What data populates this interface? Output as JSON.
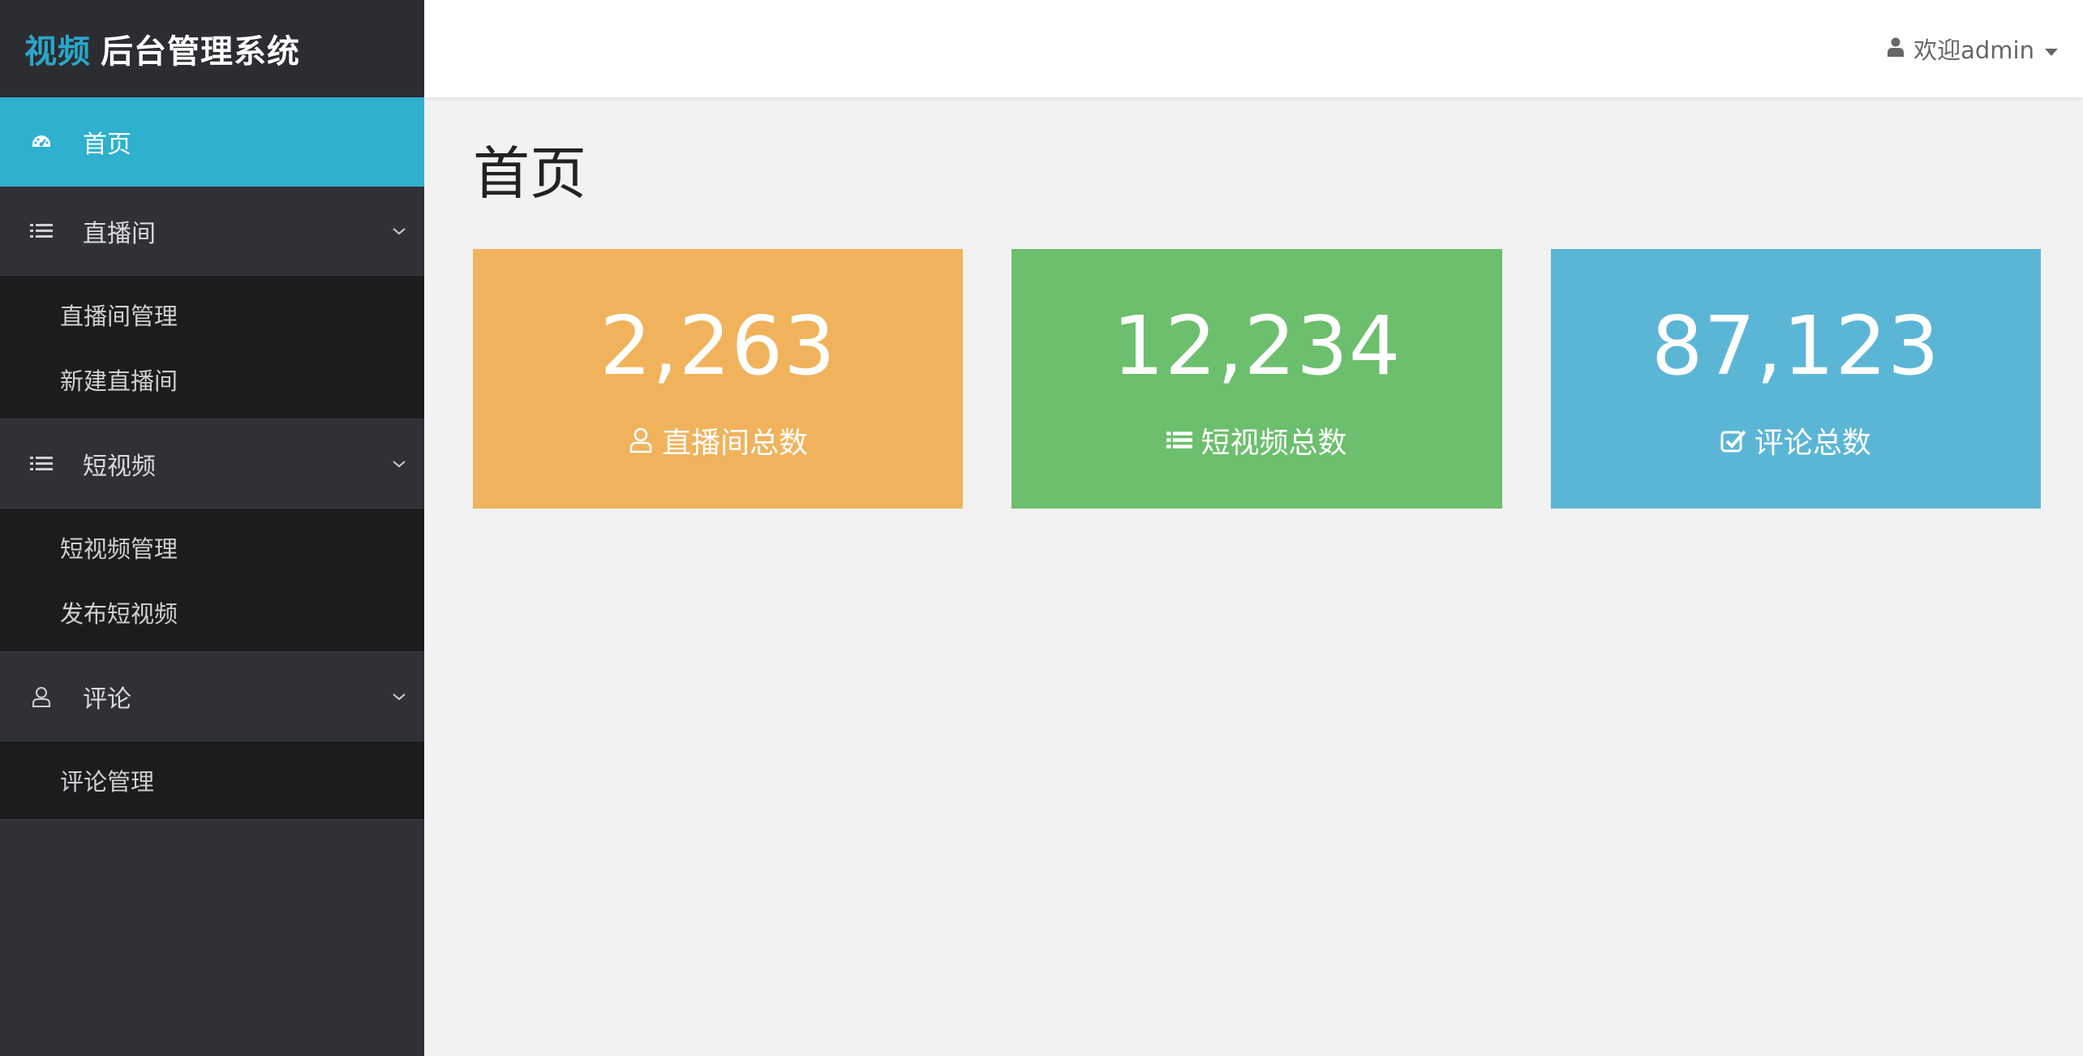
{
  "brand": {
    "accent": "视频",
    "rest": "后台管理系统"
  },
  "topbar": {
    "user_label": "欢迎admin"
  },
  "sidebar": {
    "items": [
      {
        "label": "首页",
        "icon": "dashboard-icon",
        "active": true
      },
      {
        "label": "直播间",
        "icon": "list-icon",
        "sub": [
          "直播间管理",
          "新建直播间"
        ]
      },
      {
        "label": "短视频",
        "icon": "list-icon",
        "sub": [
          "短视频管理",
          "发布短视频"
        ]
      },
      {
        "label": "评论",
        "icon": "user-icon",
        "sub": [
          "评论管理"
        ]
      }
    ]
  },
  "main": {
    "title": "首页",
    "cards": [
      {
        "value": "2,263",
        "label": "直播间总数",
        "icon": "user-outline-icon",
        "color": "#f0b35c"
      },
      {
        "value": "12,234",
        "label": "短视频总数",
        "icon": "list-icon",
        "color": "#6cbf6c"
      },
      {
        "value": "87,123",
        "label": "评论总数",
        "icon": "checkbox-icon",
        "color": "#5bb6d5"
      }
    ]
  },
  "colors": {
    "sidebar_bg": "#2f3136",
    "submenu_bg": "#1b1c1e",
    "active_bg": "#2fb0cf",
    "brand_accent": "#2aa6c9",
    "page_bg": "#f2f2f2"
  }
}
